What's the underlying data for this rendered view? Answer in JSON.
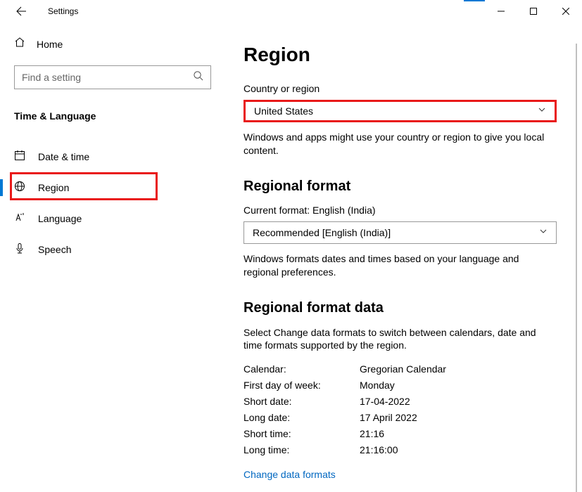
{
  "window": {
    "title": "Settings"
  },
  "sidebar": {
    "home": "Home",
    "search_placeholder": "Find a setting",
    "category": "Time & Language",
    "items": [
      {
        "label": "Date & time"
      },
      {
        "label": "Region"
      },
      {
        "label": "Language"
      },
      {
        "label": "Speech"
      }
    ]
  },
  "main": {
    "title": "Region",
    "country": {
      "label": "Country or region",
      "value": "United States",
      "helper": "Windows and apps might use your country or region to give you local content."
    },
    "regional_format": {
      "title": "Regional format",
      "current_label": "Current format: ",
      "current_value": "English (India)",
      "dropdown_value": "Recommended [English (India)]",
      "helper": "Windows formats dates and times based on your language and regional preferences."
    },
    "format_data": {
      "title": "Regional format data",
      "intro": "Select Change data formats to switch between calendars, date and time formats supported by the region.",
      "rows": [
        {
          "key": "Calendar:",
          "value": "Gregorian Calendar"
        },
        {
          "key": "First day of week:",
          "value": "Monday"
        },
        {
          "key": "Short date:",
          "value": "17-04-2022"
        },
        {
          "key": "Long date:",
          "value": "17 April 2022"
        },
        {
          "key": "Short time:",
          "value": "21:16"
        },
        {
          "key": "Long time:",
          "value": "21:16:00"
        }
      ],
      "link": "Change data formats"
    }
  }
}
